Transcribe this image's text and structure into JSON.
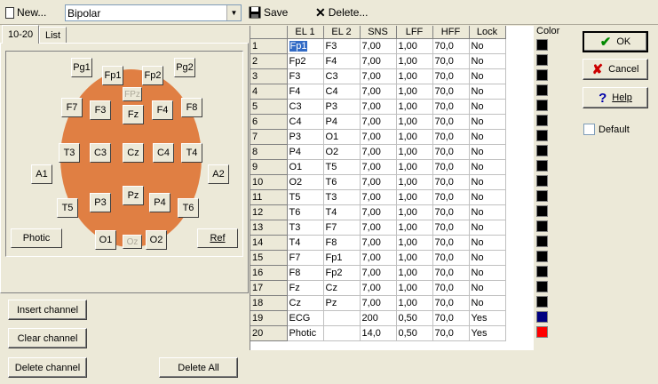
{
  "toolbar": {
    "new_label": "New...",
    "montage_value": "Bipolar",
    "save_label": "Save",
    "delete_label": "Delete..."
  },
  "tabs": [
    {
      "label": "10-20"
    },
    {
      "label": "List"
    }
  ],
  "electrodes": {
    "Pg1": "Pg1",
    "Pg2": "Pg2",
    "Fp1": "Fp1",
    "Fp2": "Fp2",
    "FPz": "FPz",
    "F7": "F7",
    "F3": "F3",
    "Fz": "Fz",
    "F4": "F4",
    "F8": "F8",
    "A1": "A1",
    "T3": "T3",
    "C3": "C3",
    "Cz": "Cz",
    "C4": "C4",
    "T4": "T4",
    "A2": "A2",
    "T5": "T5",
    "P3": "P3",
    "Pz": "Pz",
    "P4": "P4",
    "T6": "T6",
    "Photic": "Photic",
    "O1": "O1",
    "Oz": "Oz",
    "O2": "O2",
    "Ref": "Ref"
  },
  "grid": {
    "columns": [
      "EL 1",
      "EL 2",
      "SNS",
      "LFF",
      "HFF",
      "Lock"
    ],
    "rows": [
      {
        "n": "1",
        "el1": "Fp1",
        "el2": "F3",
        "sns": "7,00",
        "lff": "1,00",
        "hff": "70,0",
        "lock": "No"
      },
      {
        "n": "2",
        "el1": "Fp2",
        "el2": "F4",
        "sns": "7,00",
        "lff": "1,00",
        "hff": "70,0",
        "lock": "No"
      },
      {
        "n": "3",
        "el1": "F3",
        "el2": "C3",
        "sns": "7,00",
        "lff": "1,00",
        "hff": "70,0",
        "lock": "No"
      },
      {
        "n": "4",
        "el1": "F4",
        "el2": "C4",
        "sns": "7,00",
        "lff": "1,00",
        "hff": "70,0",
        "lock": "No"
      },
      {
        "n": "5",
        "el1": "C3",
        "el2": "P3",
        "sns": "7,00",
        "lff": "1,00",
        "hff": "70,0",
        "lock": "No"
      },
      {
        "n": "6",
        "el1": "C4",
        "el2": "P4",
        "sns": "7,00",
        "lff": "1,00",
        "hff": "70,0",
        "lock": "No"
      },
      {
        "n": "7",
        "el1": "P3",
        "el2": "O1",
        "sns": "7,00",
        "lff": "1,00",
        "hff": "70,0",
        "lock": "No"
      },
      {
        "n": "8",
        "el1": "P4",
        "el2": "O2",
        "sns": "7,00",
        "lff": "1,00",
        "hff": "70,0",
        "lock": "No"
      },
      {
        "n": "9",
        "el1": "O1",
        "el2": "T5",
        "sns": "7,00",
        "lff": "1,00",
        "hff": "70,0",
        "lock": "No"
      },
      {
        "n": "10",
        "el1": "O2",
        "el2": "T6",
        "sns": "7,00",
        "lff": "1,00",
        "hff": "70,0",
        "lock": "No"
      },
      {
        "n": "11",
        "el1": "T5",
        "el2": "T3",
        "sns": "7,00",
        "lff": "1,00",
        "hff": "70,0",
        "lock": "No"
      },
      {
        "n": "12",
        "el1": "T6",
        "el2": "T4",
        "sns": "7,00",
        "lff": "1,00",
        "hff": "70,0",
        "lock": "No"
      },
      {
        "n": "13",
        "el1": "T3",
        "el2": "F7",
        "sns": "7,00",
        "lff": "1,00",
        "hff": "70,0",
        "lock": "No"
      },
      {
        "n": "14",
        "el1": "T4",
        "el2": "F8",
        "sns": "7,00",
        "lff": "1,00",
        "hff": "70,0",
        "lock": "No"
      },
      {
        "n": "15",
        "el1": "F7",
        "el2": "Fp1",
        "sns": "7,00",
        "lff": "1,00",
        "hff": "70,0",
        "lock": "No"
      },
      {
        "n": "16",
        "el1": "F8",
        "el2": "Fp2",
        "sns": "7,00",
        "lff": "1,00",
        "hff": "70,0",
        "lock": "No"
      },
      {
        "n": "17",
        "el1": "Fz",
        "el2": "Cz",
        "sns": "7,00",
        "lff": "1,00",
        "hff": "70,0",
        "lock": "No"
      },
      {
        "n": "18",
        "el1": "Cz",
        "el2": "Pz",
        "sns": "7,00",
        "lff": "1,00",
        "hff": "70,0",
        "lock": "No"
      },
      {
        "n": "19",
        "el1": "ECG",
        "el2": "",
        "sns": "200",
        "lff": "0,50",
        "hff": "70,0",
        "lock": "Yes"
      },
      {
        "n": "20",
        "el1": "Photic",
        "el2": "",
        "sns": "14,0",
        "lff": "0,50",
        "hff": "70,0",
        "lock": "Yes"
      }
    ]
  },
  "color_label": "Color",
  "swatch_colors": [
    "#000000",
    "#000000",
    "#000000",
    "#000000",
    "#000000",
    "#000000",
    "#000000",
    "#000000",
    "#000000",
    "#000000",
    "#000000",
    "#000000",
    "#000000",
    "#000000",
    "#000000",
    "#000000",
    "#000000",
    "#000000",
    "#000080",
    "#ff0000"
  ],
  "buttons": {
    "ok": "OK",
    "cancel": "Cancel",
    "help": "Help",
    "default_label": "Default",
    "insert_channel": "Insert channel",
    "clear_channel": "Clear channel",
    "delete_channel": "Delete channel",
    "delete_all": "Delete All"
  }
}
